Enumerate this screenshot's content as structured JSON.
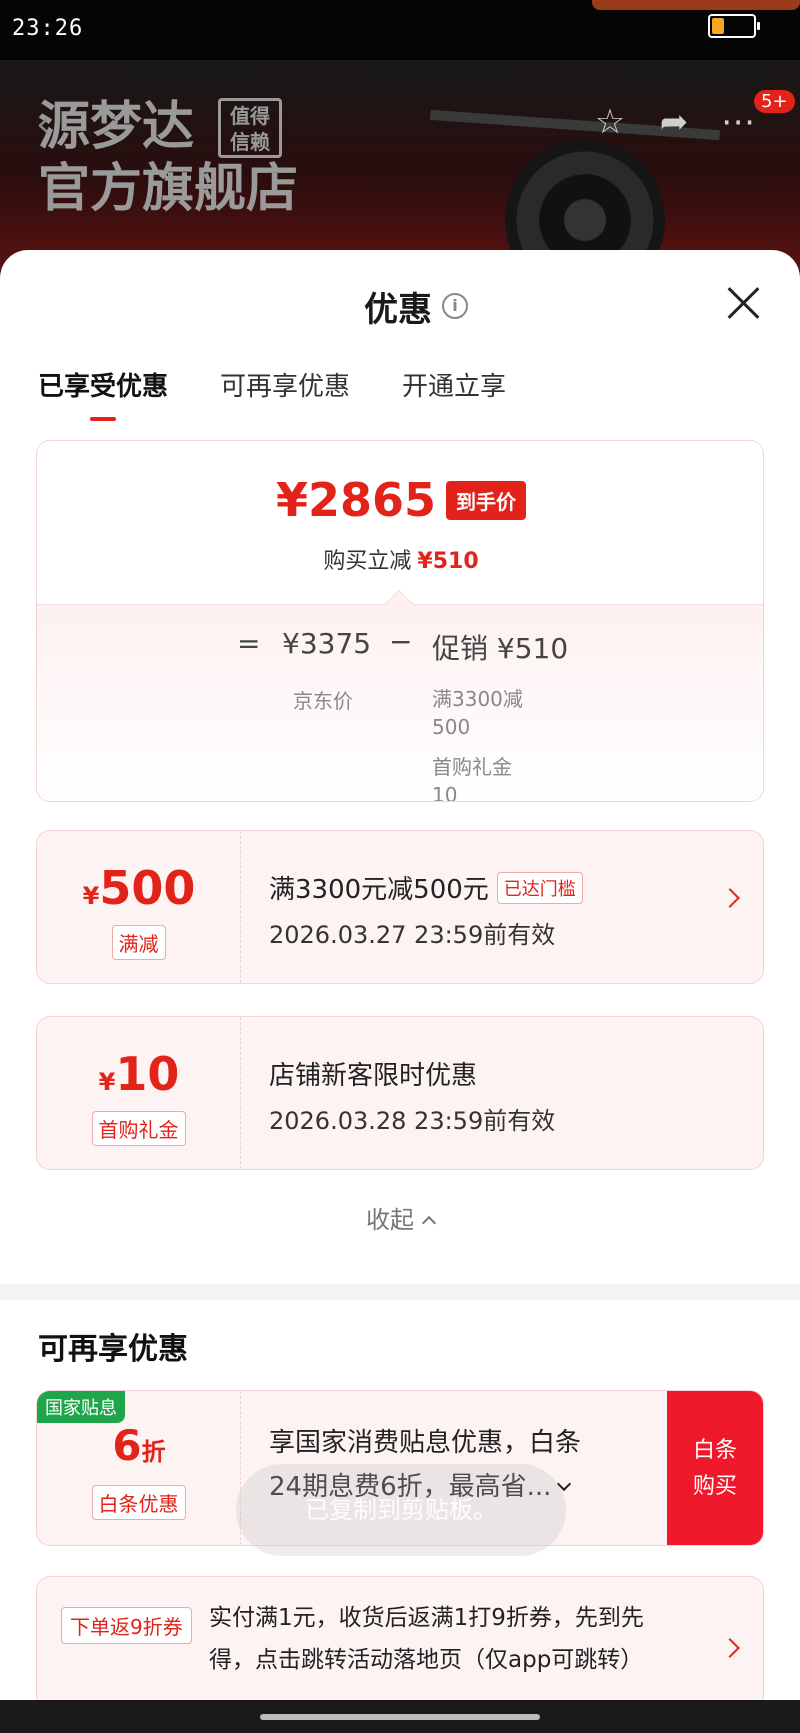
{
  "status_bar": {
    "time": "23:26",
    "battery_level": 0.3,
    "battery_color": "#f5a623"
  },
  "store": {
    "name_line1": "源梦达",
    "name_line2": "官方旗舰店",
    "badge_line1": "值得",
    "badge_line2": "信赖",
    "notification_count": "5+"
  },
  "sheet": {
    "title": "优惠",
    "tabs": [
      {
        "label": "已享受优惠",
        "active": true
      },
      {
        "label": "可再享优惠",
        "active": false
      },
      {
        "label": "开通立享",
        "active": false
      }
    ]
  },
  "summary": {
    "final_price": "¥2865",
    "final_price_tag": "到手价",
    "saving_label": "购买立减",
    "saving_amount": "¥510",
    "equals": "=",
    "base_price": "¥3375",
    "base_price_label": "京东价",
    "minus": "−",
    "promo_title": "促销 ¥510",
    "promo_lines": [
      "满3300减",
      "500",
      "首购礼金10"
    ]
  },
  "coupons": [
    {
      "yen": "¥",
      "amount": "500",
      "tag": "满减",
      "title": "满3300元减500元",
      "badge": "已达门槛",
      "valid_until": "2026.03.27 23:59前有效"
    },
    {
      "yen": "¥",
      "amount": "10",
      "tag": "首购礼金",
      "title": "店铺新客限时优惠",
      "badge": "",
      "valid_until": "2026.03.28 23:59前有效"
    }
  ],
  "collapse_label": "收起",
  "more_section": {
    "title": "可再享优惠",
    "gov_subsidy": {
      "label": "国家贴息",
      "discount": "6",
      "discount_unit": "折",
      "tag": "白条优惠",
      "text_line1": "享国家消费贴息优惠，白条",
      "text_line2": "24期息费6折，最高省...",
      "button_line1": "白条",
      "button_line2": "购买"
    },
    "toast": "已复制到剪贴板。",
    "return_coupon": {
      "tag": "下单返9折券",
      "text_line1": "实付满1元，收货后返满1打9折券，先到先",
      "text_line2": "得，点击跳转活动落地页（仅app可跳转）"
    }
  },
  "colors": {
    "accent": "#e2231a",
    "subsidy_green": "#1fa64b"
  }
}
